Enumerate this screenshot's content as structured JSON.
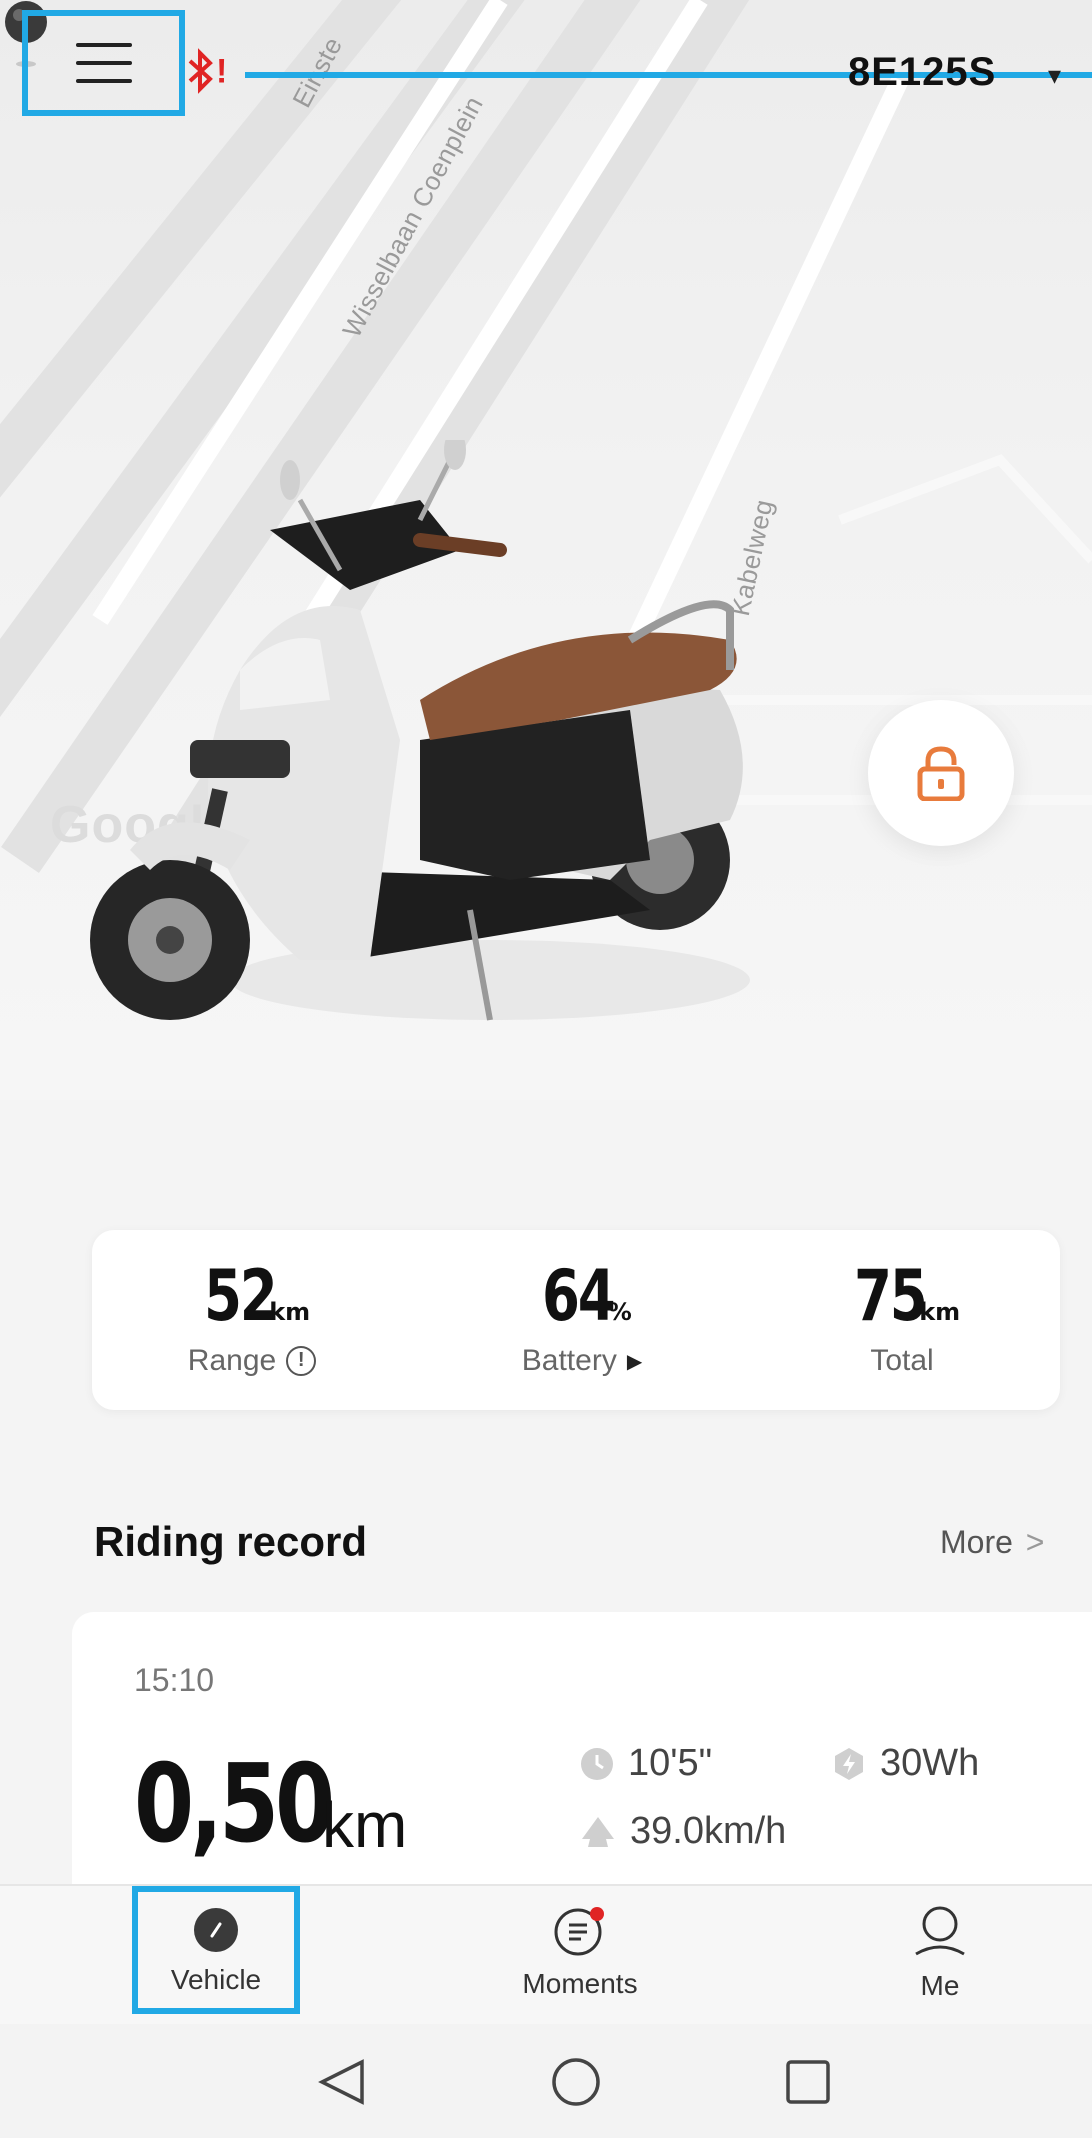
{
  "header": {
    "vehicle_id": "8E125S",
    "menu_icon": "hamburger-icon",
    "bluetooth_icon": "bluetooth-warning-icon",
    "bluetooth_mark": "!",
    "dropdown_icon": "caret-down-icon",
    "dropdown_glyph": "▾"
  },
  "map": {
    "streets": [
      "Einste",
      "Wisselbaan Coenplein",
      "Kabelweg"
    ],
    "watermark": "Google",
    "pin_icon": "map-pin-icon"
  },
  "lock": {
    "icon": "unlocked-padlock-icon",
    "color": "#e87b3c"
  },
  "stats": [
    {
      "value": "52",
      "unit": "km",
      "label": "Range",
      "extra_icon": "info-icon",
      "extra_glyph": "!"
    },
    {
      "value": "64",
      "unit": "%",
      "label": "Battery",
      "extra_icon": "play-triangle-icon",
      "extra_glyph": "▶"
    },
    {
      "value": "75",
      "unit": "km",
      "label": "Total"
    }
  ],
  "riding_record": {
    "title": "Riding record",
    "more_label": "More",
    "more_glyph": ">",
    "record": {
      "time": "15:10",
      "distance": "0,50",
      "distance_unit": "km",
      "duration": "10'5\"",
      "energy": "30Wh",
      "speed": "39.0km/h"
    }
  },
  "tabs": [
    {
      "label": "Vehicle",
      "icon": "scooter-tab-icon",
      "active": true
    },
    {
      "label": "Moments",
      "icon": "chat-bubble-icon",
      "badge": true
    },
    {
      "label": "Me",
      "icon": "person-icon"
    }
  ],
  "system_nav": [
    "back-icon",
    "home-icon",
    "recents-icon"
  ],
  "colors": {
    "accent_blue": "#21a9e5",
    "alert_red": "#e02424",
    "lock_orange": "#e87b3c"
  }
}
